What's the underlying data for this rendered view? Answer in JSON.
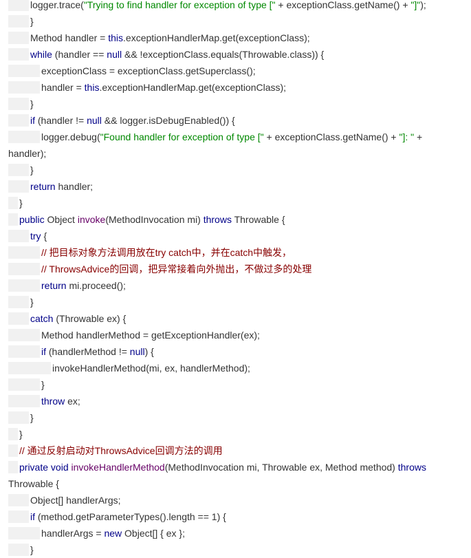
{
  "lines": [
    {
      "indent": 2,
      "segs": [
        [
          "pl",
          "logger.trace("
        ],
        [
          "str",
          "\"Trying to find handler for exception of type [\""
        ],
        [
          "pl",
          " + exceptionClass.getName() + "
        ],
        [
          "str",
          "\"]\""
        ],
        [
          "pl",
          ");"
        ]
      ]
    },
    {
      "indent": 2,
      "segs": [
        [
          "pl",
          "}"
        ]
      ]
    },
    {
      "indent": 2,
      "segs": [
        [
          "pl",
          "Method handler = "
        ],
        [
          "kw",
          "this"
        ],
        [
          "pl",
          ".exceptionHandlerMap.get(exceptionClass);"
        ]
      ]
    },
    {
      "indent": 2,
      "segs": [
        [
          "kw",
          "while"
        ],
        [
          "pl",
          " (handler == "
        ],
        [
          "kw",
          "null"
        ],
        [
          "pl",
          " && !exceptionClass.equals(Throwable.class)) {"
        ]
      ]
    },
    {
      "indent": 3,
      "segs": [
        [
          "pl",
          "exceptionClass = exceptionClass.getSuperclass();"
        ]
      ]
    },
    {
      "indent": 3,
      "segs": [
        [
          "pl",
          "handler = "
        ],
        [
          "kw",
          "this"
        ],
        [
          "pl",
          ".exceptionHandlerMap.get(exceptionClass);"
        ]
      ]
    },
    {
      "indent": 2,
      "segs": [
        [
          "pl",
          "}"
        ]
      ]
    },
    {
      "indent": 2,
      "segs": [
        [
          "kw",
          "if"
        ],
        [
          "pl",
          " (handler != "
        ],
        [
          "kw",
          "null"
        ],
        [
          "pl",
          " && logger.isDebugEnabled()) {"
        ]
      ]
    },
    {
      "indent": 3,
      "segs": [
        [
          "pl",
          "logger.debug("
        ],
        [
          "str",
          "\"Found handler for exception of type [\""
        ],
        [
          "pl",
          " + exceptionClass.getName() + "
        ],
        [
          "str",
          "\"]: \""
        ],
        [
          "pl",
          " +"
        ]
      ]
    },
    {
      "indent": 0,
      "segs": [
        [
          "pl",
          "handler);"
        ]
      ]
    },
    {
      "indent": 2,
      "segs": [
        [
          "pl",
          "}"
        ]
      ]
    },
    {
      "indent": 2,
      "segs": [
        [
          "kw",
          "return"
        ],
        [
          "pl",
          " handler;"
        ]
      ]
    },
    {
      "indent": 1,
      "segs": [
        [
          "pl",
          "}"
        ]
      ]
    },
    {
      "indent": 1,
      "segs": [
        [
          "kw",
          "public"
        ],
        [
          "pl",
          " Object "
        ],
        [
          "fn",
          "invoke"
        ],
        [
          "pl",
          "(MethodInvocation mi) "
        ],
        [
          "kw",
          "throws"
        ],
        [
          "pl",
          " Throwable {"
        ]
      ]
    },
    {
      "indent": 2,
      "segs": [
        [
          "kw",
          "try"
        ],
        [
          "pl",
          " {"
        ]
      ]
    },
    {
      "indent": 3,
      "segs": [
        [
          "cmt",
          "// 把目标对象方法调用放在try catch中，并在catch中触发，"
        ]
      ]
    },
    {
      "indent": 3,
      "segs": [
        [
          "cmt",
          "// ThrowsAdvice的回调，把异常接着向外抛出，不做过多的处理"
        ]
      ]
    },
    {
      "indent": 3,
      "segs": [
        [
          "kw",
          "return"
        ],
        [
          "pl",
          " mi.proceed();"
        ]
      ]
    },
    {
      "indent": 2,
      "segs": [
        [
          "pl",
          "}"
        ]
      ]
    },
    {
      "indent": 2,
      "segs": [
        [
          "kw",
          "catch"
        ],
        [
          "pl",
          " (Throwable ex) {"
        ]
      ]
    },
    {
      "indent": 3,
      "segs": [
        [
          "pl",
          "Method handlerMethod = getExceptionHandler(ex);"
        ]
      ]
    },
    {
      "indent": 3,
      "segs": [
        [
          "kw",
          "if"
        ],
        [
          "pl",
          " (handlerMethod != "
        ],
        [
          "kw",
          "null"
        ],
        [
          "pl",
          ") {"
        ]
      ]
    },
    {
      "indent": 4,
      "segs": [
        [
          "pl",
          "invokeHandlerMethod(mi, ex, handlerMethod);"
        ]
      ]
    },
    {
      "indent": 3,
      "segs": [
        [
          "pl",
          "}"
        ]
      ]
    },
    {
      "indent": 3,
      "segs": [
        [
          "kw",
          "throw"
        ],
        [
          "pl",
          " ex;"
        ]
      ]
    },
    {
      "indent": 2,
      "segs": [
        [
          "pl",
          "}"
        ]
      ]
    },
    {
      "indent": 1,
      "segs": [
        [
          "pl",
          "}"
        ]
      ]
    },
    {
      "indent": 1,
      "segs": [
        [
          "cmt",
          "// 通过反射启动对ThrowsAdvice回调方法的调用"
        ]
      ]
    },
    {
      "indent": 1,
      "segs": [
        [
          "kw",
          "private"
        ],
        [
          "pl",
          " "
        ],
        [
          "kw",
          "void"
        ],
        [
          "pl",
          " "
        ],
        [
          "fn",
          "invokeHandlerMethod"
        ],
        [
          "pl",
          "(MethodInvocation mi, Throwable ex, Method method) "
        ],
        [
          "kw",
          "throws"
        ]
      ]
    },
    {
      "indent": 0,
      "segs": [
        [
          "pl",
          "Throwable {"
        ]
      ]
    },
    {
      "indent": 2,
      "segs": [
        [
          "pl",
          "Object[] handlerArgs;"
        ]
      ]
    },
    {
      "indent": 2,
      "segs": [
        [
          "kw",
          "if"
        ],
        [
          "pl",
          " (method.getParameterTypes().length == 1) {"
        ]
      ]
    },
    {
      "indent": 3,
      "segs": [
        [
          "pl",
          "handlerArgs = "
        ],
        [
          "kw",
          "new"
        ],
        [
          "pl",
          " Object[] { ex };"
        ]
      ]
    },
    {
      "indent": 2,
      "segs": [
        [
          "pl",
          "}"
        ]
      ]
    }
  ]
}
